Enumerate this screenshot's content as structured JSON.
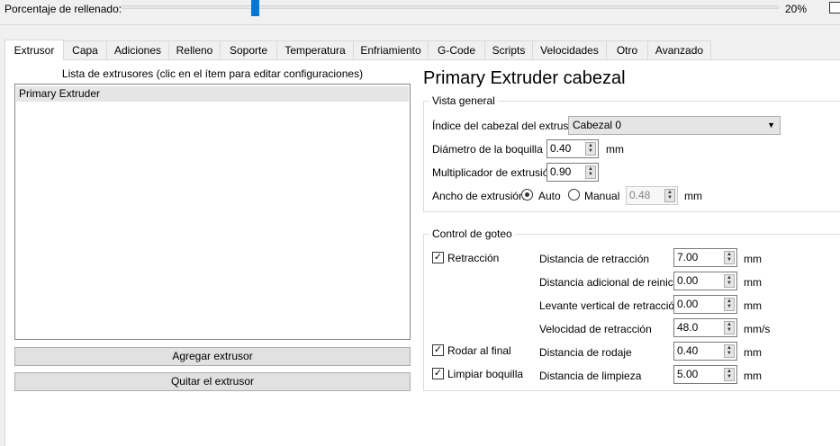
{
  "fill": {
    "label": "Porcentaje de rellenado:",
    "value_text": "20%",
    "value_percent": 20
  },
  "tabs": [
    "Extrusor",
    "Capa",
    "Adiciones",
    "Relleno",
    "Soporte",
    "Temperatura",
    "Enfriamiento",
    "G-Code",
    "Scripts",
    "Velocidades",
    "Otro",
    "Avanzado"
  ],
  "left": {
    "list_label": "Lista de extrusores (clic en el ítem para editar configuraciones)",
    "items": [
      "Primary Extruder"
    ],
    "add_button": "Agregar extrusor",
    "remove_button": "Quitar el extrusor"
  },
  "right": {
    "title": "Primary Extruder cabezal",
    "overview": {
      "title": "Vista general",
      "head_index_label": "Índice del cabezal del extrusor",
      "head_index_value": "Cabezal 0",
      "nozzle_label": "Diámetro de la boquilla",
      "nozzle_value": "0.40",
      "nozzle_unit": "mm",
      "mult_label": "Multiplicador de extrusión",
      "mult_value": "0.90",
      "width_label": "Ancho de extrusión",
      "auto_label": "Auto",
      "manual_label": "Manual",
      "manual_value": "0.48",
      "width_unit": "mm"
    },
    "ooze": {
      "title": "Control de goteo",
      "retraction_label": "Retracción",
      "coast_label": "Rodar al final",
      "wipe_label": "Limpiar boquilla",
      "fields": [
        {
          "label": "Distancia de retracción",
          "value": "7.00",
          "unit": "mm"
        },
        {
          "label": "Distancia adicional de reinicio",
          "value": "0.00",
          "unit": "mm"
        },
        {
          "label": "Levante vertical de retracción",
          "value": "0.00",
          "unit": "mm"
        },
        {
          "label": "Velocidad de retracción",
          "value": "48.0",
          "unit": "mm/s"
        },
        {
          "label": "Distancia de rodaje",
          "value": "0.40",
          "unit": "mm"
        },
        {
          "label": "Distancia de limpieza",
          "value": "5.00",
          "unit": "mm"
        }
      ]
    }
  }
}
